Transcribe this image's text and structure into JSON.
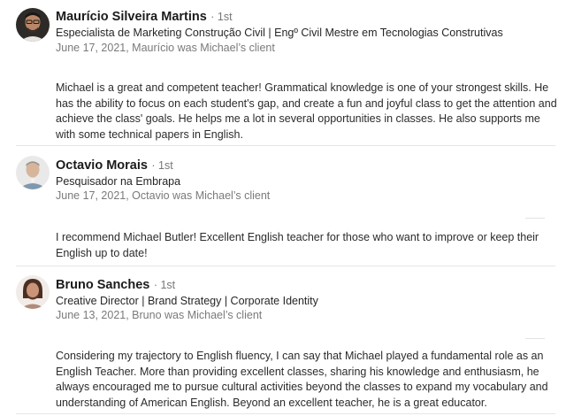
{
  "recommendations": [
    {
      "name": "Maurício Silveira Martins",
      "degree": "· 1st",
      "headline": "Especialista de Marketing Construção Civil | Engº Civil Mestre em Tecnologias Construtivas",
      "meta": "June 17, 2021, Maurício was Michael’s client",
      "text": "Michael is a great and competent teacher! Grammatical knowledge is one of your strongest skills. He has the ability to focus on each student's gap, and create a fun and joyful class to get the attention and achieve the class' goals. He helps me a lot in several opportunities in classes. He also supports me with some technical papers in English."
    },
    {
      "name": "Octavio Morais",
      "degree": "· 1st",
      "headline": "Pesquisador na Embrapa",
      "meta": "June 17, 2021, Octavio was Michael’s client",
      "text": "I recommend Michael Butler! Excellent English teacher for those who want to improve or keep their English up to date!"
    },
    {
      "name": "Bruno Sanches",
      "degree": "· 1st",
      "headline": "Creative Director | Brand Strategy | Corporate Identity",
      "meta": "June 13, 2021, Bruno was Michael’s client",
      "text": "Considering my trajectory to English fluency, I can say that Michael played a fundamental role as an English Teacher. More than providing excellent classes, sharing his knowledge and enthusiasm, he always encouraged me to pursue cultural activities beyond the classes to expand my vocabulary and understanding of American English. Beyond an excellent teacher, he is a great educator."
    }
  ]
}
